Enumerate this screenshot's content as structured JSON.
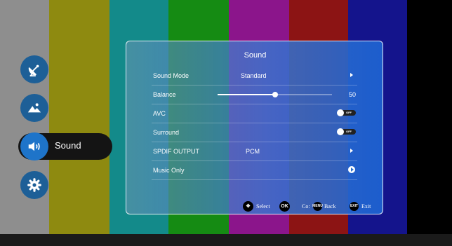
{
  "colors": {
    "bars": [
      "#8e8e8e",
      "#8e8a10",
      "#138a8a",
      "#158b13",
      "#8b158b",
      "#8c1414",
      "#14148c",
      "#000000"
    ],
    "panel_accent": "#2a6fcc",
    "selected_nav": "#1e74c9"
  },
  "sidebar": {
    "items": [
      {
        "icon": "satellite-dish-icon"
      },
      {
        "icon": "picture-icon"
      },
      {
        "icon": "speaker-icon",
        "label": "Sound",
        "selected": true
      },
      {
        "icon": "gear-icon"
      }
    ]
  },
  "panel": {
    "title": "Sound",
    "rows": [
      {
        "label": "Sound Mode",
        "value": "Standard",
        "control": "arrow"
      },
      {
        "label": "Balance",
        "value": "50",
        "control": "slider",
        "level_percent": 50
      },
      {
        "label": "AVC",
        "value": "OFF",
        "control": "toggle"
      },
      {
        "label": "Surround",
        "value": "OFF",
        "control": "toggle"
      },
      {
        "label": "SPDIF OUTPUT",
        "value": "PCM",
        "control": "arrow"
      },
      {
        "label": "Music Only",
        "value": "",
        "control": "play"
      }
    ]
  },
  "footer": {
    "select_label": "Select",
    "ok_btn": "OK",
    "confirm_label": "Co:",
    "menu_btn": "MENU",
    "back_label": "Back",
    "exit_btn": "EXIT",
    "exit_label": "Exit"
  }
}
